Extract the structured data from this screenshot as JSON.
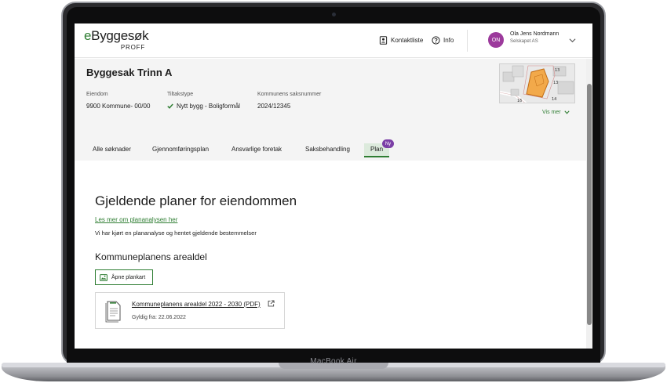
{
  "device": {
    "label": "MacBook Air"
  },
  "header": {
    "logo_main": "eByggesøk",
    "logo_sub": "PROFF",
    "contact_label": "Kontaktliste",
    "info_label": "Info",
    "user": {
      "initials": "ON",
      "name": "Ola Jens Nordmann",
      "org": "Selskapet AS"
    }
  },
  "case": {
    "title": "Byggesak Trinn A",
    "fields": [
      {
        "label": "Eiendom",
        "value": "9900 Kommune- 00/00"
      },
      {
        "label": "Tiltakstype",
        "value": "Nytt bygg - Boligformål"
      },
      {
        "label": "Kommunens saksnummer",
        "value": "2024/12345"
      }
    ],
    "map_labels": [
      "13",
      "13",
      "16",
      "14"
    ],
    "vis_mer_label": "Vis mer"
  },
  "tabs": [
    {
      "label": "Alle søknader"
    },
    {
      "label": "Gjennomføringsplan"
    },
    {
      "label": "Ansvarlige foretak"
    },
    {
      "label": "Saksbehandling"
    },
    {
      "label": "Plan",
      "active": true,
      "badge": "Ny"
    }
  ],
  "content": {
    "heading": "Gjeldende planer for eiendommen",
    "link_text": "Les mer om plananalysen her",
    "description": "Vi har kjørt en plananalyse og hentet gjeldende bestemmelser",
    "subheading": "Kommuneplanens arealdel",
    "open_map_label": "Åpne plankart",
    "document": {
      "title": "Kommuneplanens arealdel 2022 - 2030 (PDF)",
      "valid_from": "Gyldig fra: 22.06.2022"
    }
  },
  "colors": {
    "accent": "#2e7d32",
    "avatar": "#9c3a9c",
    "badge": "#7b3fa6",
    "tab_active_bg": "#dceadc",
    "plot_fill": "#f2a94a"
  }
}
